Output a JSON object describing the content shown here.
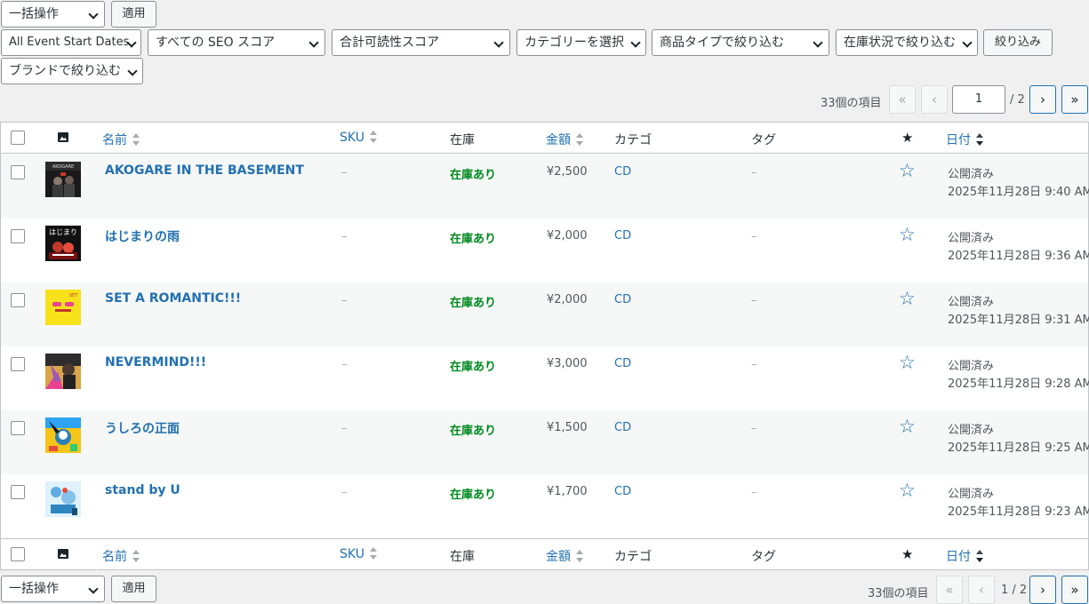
{
  "top_bulk": {
    "label": "一括操作",
    "apply": "適用"
  },
  "filters": [
    {
      "label": "All Event Start Dates"
    },
    {
      "label": "すべての SEO スコア"
    },
    {
      "label": "合計可読性スコア"
    },
    {
      "label": "カテゴリーを選択"
    },
    {
      "label": "商品タイプで絞り込む"
    },
    {
      "label": "在庫状況で絞り込む"
    },
    {
      "label": "ブランドで絞り込む"
    }
  ],
  "filter_button": "絞り込み",
  "pagination_top": {
    "count": "33個の項目",
    "first": "«",
    "prev": "‹",
    "current": "1",
    "total": "/ 2",
    "next": "›",
    "last": "»"
  },
  "pagination_bottom": {
    "count": "33個の項目",
    "first": "«",
    "prev": "‹",
    "current": "1 / 2",
    "next": "›",
    "last": "»"
  },
  "columns": {
    "name": "名前",
    "sku": "SKU",
    "stock": "在庫",
    "price": "金額",
    "category": "カテゴ",
    "tags": "タグ",
    "date": "日付"
  },
  "products": [
    {
      "name": "AKOGARE IN THE BASEMENT",
      "sku": "–",
      "stock": "在庫あり",
      "price": "¥2,500",
      "category": "CD",
      "tags": "–",
      "status": "公開済み",
      "date": "2025年11月28日 9:40 AM",
      "thumb": "akogare"
    },
    {
      "name": "はじまりの雨",
      "sku": "–",
      "stock": "在庫あり",
      "price": "¥2,000",
      "category": "CD",
      "tags": "–",
      "status": "公開済み",
      "date": "2025年11月28日 9:36 AM",
      "thumb": "hajimari"
    },
    {
      "name": "SET A ROMANTIC!!!",
      "sku": "–",
      "stock": "在庫あり",
      "price": "¥2,000",
      "category": "CD",
      "tags": "–",
      "status": "公開済み",
      "date": "2025年11月28日 9:31 AM",
      "thumb": "romantic"
    },
    {
      "name": "NEVERMIND!!!",
      "sku": "–",
      "stock": "在庫あり",
      "price": "¥3,000",
      "category": "CD",
      "tags": "–",
      "status": "公開済み",
      "date": "2025年11月28日 9:28 AM",
      "thumb": "nevermind"
    },
    {
      "name": "うしろの正面",
      "sku": "–",
      "stock": "在庫あり",
      "price": "¥1,500",
      "category": "CD",
      "tags": "–",
      "status": "公開済み",
      "date": "2025年11月28日 9:25 AM",
      "thumb": "ushiro"
    },
    {
      "name": "stand by U",
      "sku": "–",
      "stock": "在庫あり",
      "price": "¥1,700",
      "category": "CD",
      "tags": "–",
      "status": "公開済み",
      "date": "2025年11月28日 9:23 AM",
      "thumb": "standby"
    }
  ],
  "bottom_bulk": {
    "label": "一括操作",
    "apply": "適用"
  },
  "colors": {
    "link": "#2271b1",
    "in_stock": "#008a20",
    "background": "#f0f0f1"
  }
}
